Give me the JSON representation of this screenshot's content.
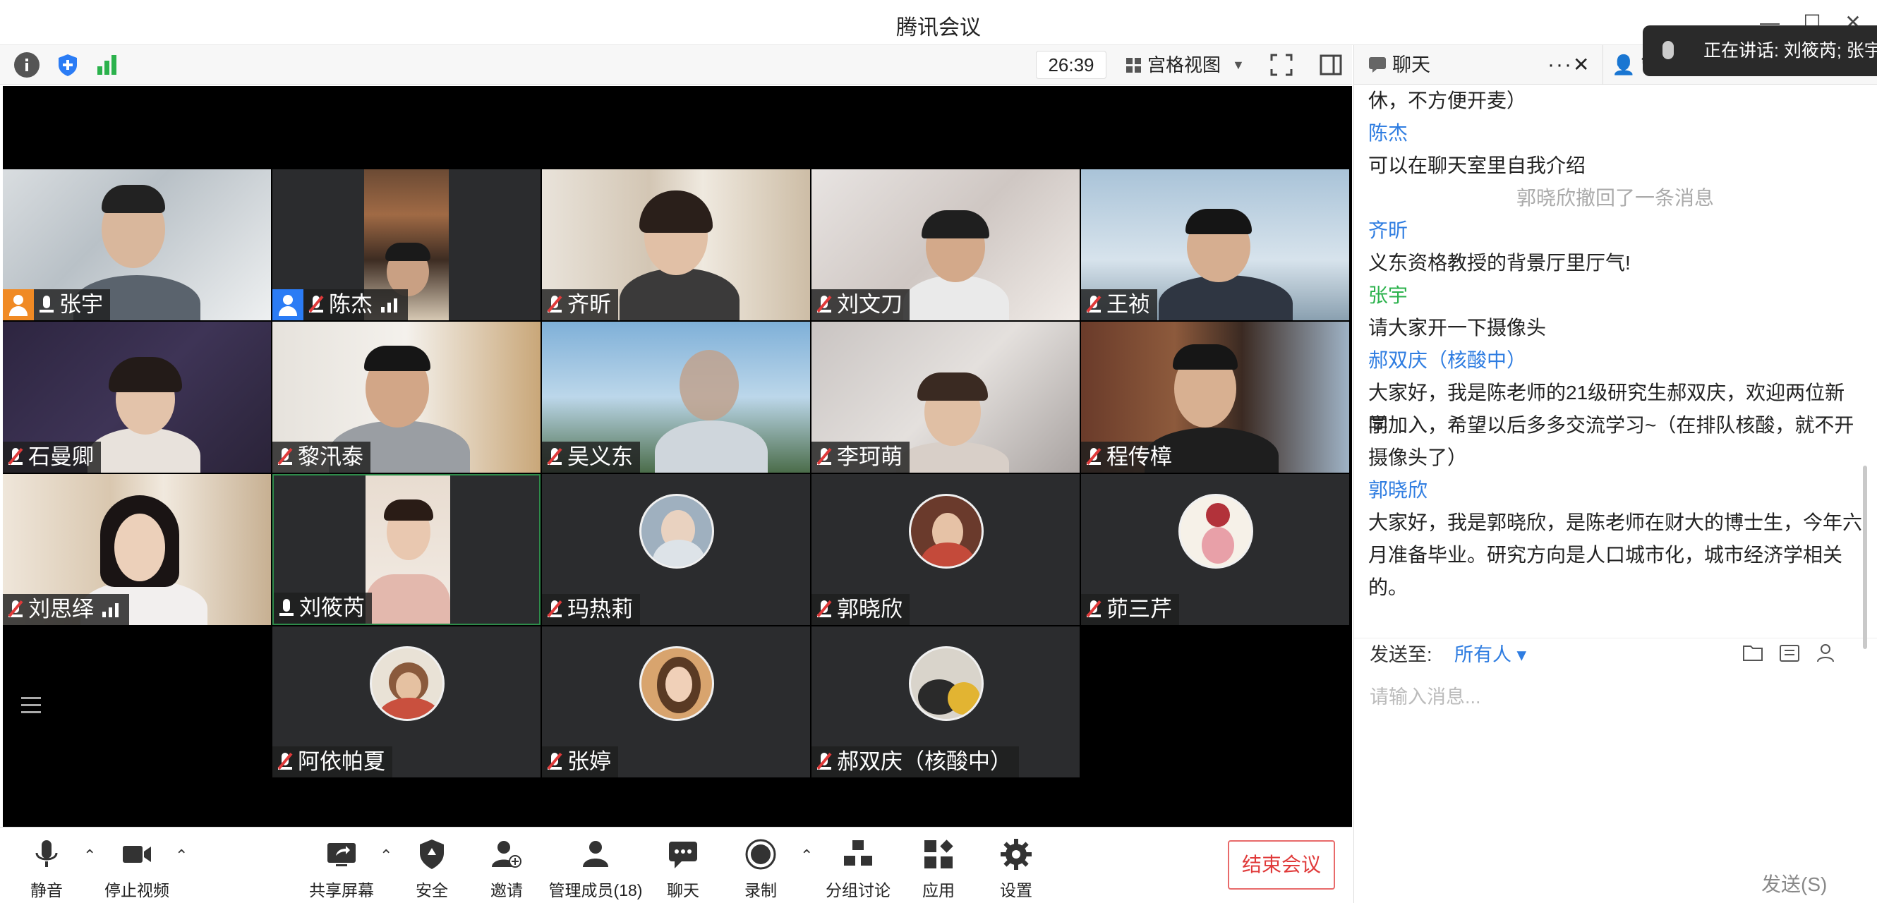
{
  "window": {
    "title": "腾讯会议"
  },
  "topbar": {
    "timer": "26:39",
    "view_label": "宫格视图"
  },
  "speaking": {
    "text": "正在讲话: 刘筱芮; 张宇;"
  },
  "tiles": [
    {
      "name": "张宇",
      "muted": false,
      "host": "orange"
    },
    {
      "name": "陈杰",
      "muted": true,
      "host": "blue",
      "signal": true
    },
    {
      "name": "齐昕",
      "muted": true
    },
    {
      "name": "刘文刀",
      "muted": true
    },
    {
      "name": "王祯",
      "muted": true
    },
    {
      "name": "石曼卿",
      "muted": true
    },
    {
      "name": "黎汛泰",
      "muted": true
    },
    {
      "name": "吴义东",
      "muted": true
    },
    {
      "name": "李珂萌",
      "muted": true
    },
    {
      "name": "程传樟",
      "muted": true
    },
    {
      "name": "刘思绎",
      "muted": true,
      "signal": true
    },
    {
      "name": "刘筱芮",
      "muted": false
    },
    {
      "name": "玛热莉",
      "muted": true
    },
    {
      "name": "郭晓欣",
      "muted": true
    },
    {
      "name": "茆三芹",
      "muted": true
    },
    {
      "name": "阿依帕夏",
      "muted": true
    },
    {
      "name": "张婷",
      "muted": true
    },
    {
      "name": "郝双庆（核酸中）",
      "muted": true
    }
  ],
  "chat": {
    "tab_label": "聊天",
    "tab2_label": "管",
    "messages": [
      {
        "kind": "text",
        "text": "休，不方便开麦）"
      },
      {
        "kind": "sender",
        "text": "陈杰"
      },
      {
        "kind": "text",
        "text": "可以在聊天室里自我介绍"
      },
      {
        "kind": "system",
        "text": "郭晓欣撤回了一条消息"
      },
      {
        "kind": "sender",
        "text": "齐昕"
      },
      {
        "kind": "text",
        "text": "义东资格教授的背景厅里厅气!"
      },
      {
        "kind": "sender_green",
        "text": "张宇"
      },
      {
        "kind": "text",
        "text": "请大家开一下摄像头"
      },
      {
        "kind": "sender",
        "text": "郝双庆（核酸中）"
      },
      {
        "kind": "text",
        "text": "大家好，我是陈老师的21级研究生郝双庆，欢迎两位新同"
      },
      {
        "kind": "text",
        "text": "学加入，希望以后多多交流学习~（在排队核酸，就不开"
      },
      {
        "kind": "text",
        "text": "摄像头了）"
      },
      {
        "kind": "sender",
        "text": "郭晓欣"
      },
      {
        "kind": "text",
        "text": "大家好，我是郭晓欣，是陈老师在财大的博士生，今年六"
      },
      {
        "kind": "text",
        "text": "月准备毕业。研究方向是人口城市化，城市经济学相关"
      },
      {
        "kind": "text",
        "text": "的。"
      }
    ],
    "send_to_label": "发送至:",
    "send_to_target": "所有人 ▾",
    "input_placeholder": "请输入消息...",
    "send_button": "发送(S)"
  },
  "toolbar": {
    "mute": "静音",
    "stop_video": "停止视频",
    "share": "共享屏幕",
    "security": "安全",
    "invite": "邀请",
    "members": "管理成员(18)",
    "chat": "聊天",
    "record": "录制",
    "breakout": "分组讨论",
    "apps": "应用",
    "settings": "设置",
    "end": "结束会议"
  }
}
